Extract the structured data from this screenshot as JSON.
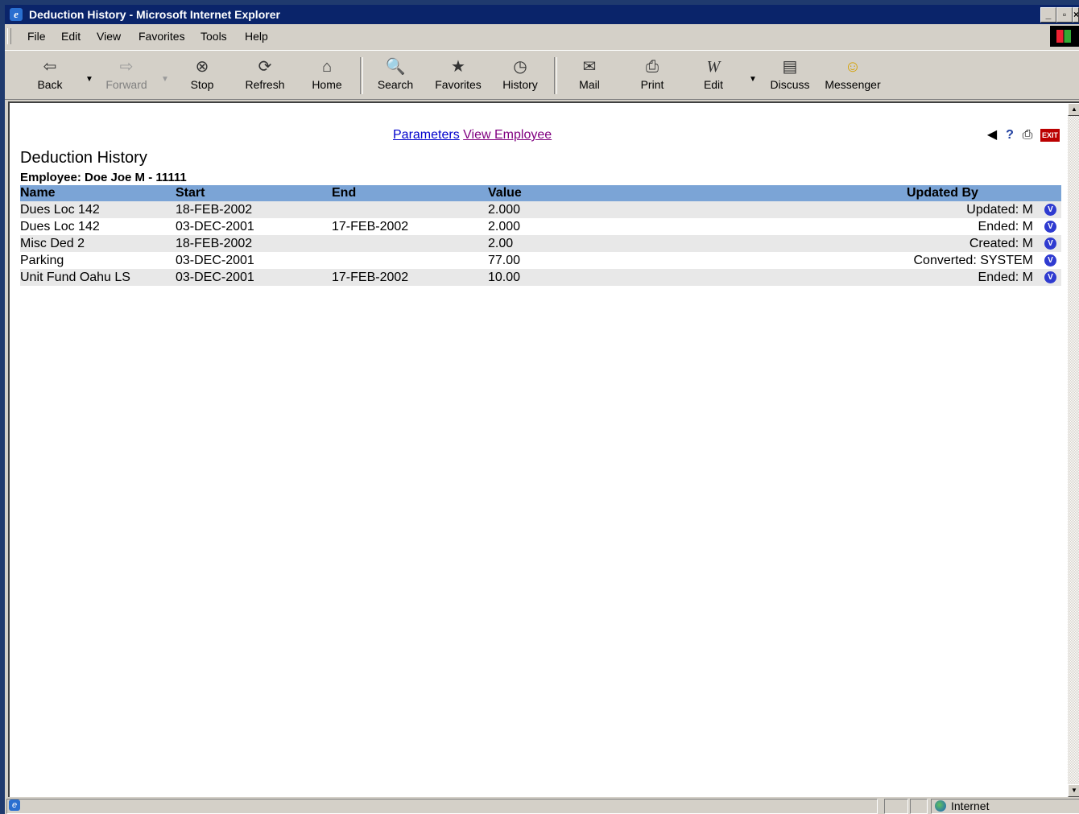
{
  "window": {
    "title": "Deduction History - Microsoft Internet Explorer",
    "controls": [
      "_",
      "▫",
      "×"
    ]
  },
  "menu": [
    "File",
    "Edit",
    "View",
    "Favorites",
    "Tools",
    "Help"
  ],
  "toolbar": [
    {
      "label": "Back",
      "icon": "back-arrow-icon",
      "glyph": "⇦",
      "enabled": true
    },
    {
      "label": "Forward",
      "icon": "forward-arrow-icon",
      "glyph": "⇨",
      "enabled": false
    },
    {
      "label": "Stop",
      "icon": "stop-icon",
      "glyph": "⊗",
      "enabled": true
    },
    {
      "label": "Refresh",
      "icon": "refresh-icon",
      "glyph": "⟳",
      "enabled": true
    },
    {
      "label": "Home",
      "icon": "home-icon",
      "glyph": "⌂",
      "enabled": true
    },
    {
      "label": "Search",
      "icon": "search-icon",
      "glyph": "🔍",
      "enabled": true
    },
    {
      "label": "Favorites",
      "icon": "favorites-icon",
      "glyph": "★",
      "enabled": true
    },
    {
      "label": "History",
      "icon": "history-icon",
      "glyph": "◷",
      "enabled": true
    },
    {
      "label": "Mail",
      "icon": "mail-icon",
      "glyph": "✉",
      "enabled": true
    },
    {
      "label": "Print",
      "icon": "print-icon",
      "glyph": "⎙",
      "enabled": true
    },
    {
      "label": "Edit",
      "icon": "edit-icon",
      "glyph": "W",
      "enabled": true
    },
    {
      "label": "Discuss",
      "icon": "discuss-icon",
      "glyph": "▤",
      "enabled": true
    },
    {
      "label": "Messenger",
      "icon": "messenger-icon",
      "glyph": "☺",
      "enabled": true
    }
  ],
  "page": {
    "links": {
      "parameters": "Parameters",
      "view_employee": "View Employee"
    },
    "title": "Deduction History",
    "employee": "Employee: Doe Joe M - 11111",
    "columns": [
      "Name",
      "Start",
      "End",
      "Value",
      "Updated By"
    ],
    "rows": [
      {
        "name": "Dues Loc 142",
        "start": "18-FEB-2002",
        "end": "",
        "value": "2.000",
        "updated_by": "Updated: M"
      },
      {
        "name": "Dues Loc 142",
        "start": "03-DEC-2001",
        "end": "17-FEB-2002",
        "value": "2.000",
        "updated_by": "Ended: M"
      },
      {
        "name": "Misc Ded 2",
        "start": "18-FEB-2002",
        "end": "",
        "value": "2.00",
        "updated_by": "Created: M"
      },
      {
        "name": "Parking",
        "start": "03-DEC-2001",
        "end": "",
        "value": "77.00",
        "updated_by": "Converted: SYSTEM"
      },
      {
        "name": "Unit Fund Oahu LS",
        "start": "03-DEC-2001",
        "end": "17-FEB-2002",
        "value": "10.00",
        "updated_by": "Ended: M"
      }
    ],
    "header_color": "#7ba4d6"
  },
  "status": {
    "zone": "Internet"
  }
}
